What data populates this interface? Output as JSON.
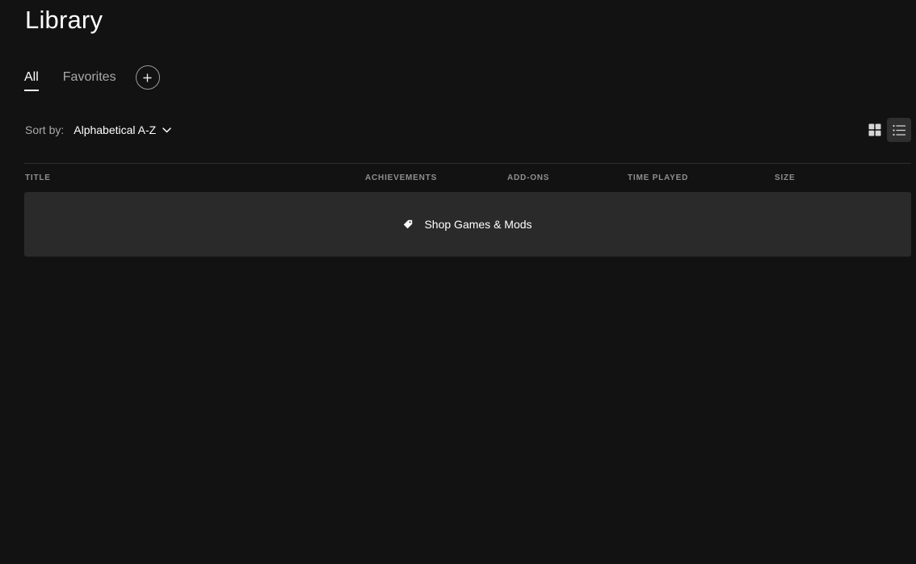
{
  "page": {
    "title": "Library"
  },
  "tabs": [
    {
      "label": "All",
      "active": true
    },
    {
      "label": "Favorites",
      "active": false
    }
  ],
  "add_collection": {
    "icon": "plus-icon"
  },
  "sort": {
    "label": "Sort by:",
    "value": "Alphabetical A-Z",
    "icon": "chevron-down-icon"
  },
  "view_toggles": {
    "grid_icon": "grid-view-icon",
    "list_icon": "list-view-icon",
    "active": "list"
  },
  "table": {
    "columns": [
      "TITLE",
      "ACHIEVEMENTS",
      "ADD-ONS",
      "TIME PLAYED",
      "SIZE"
    ]
  },
  "shop_row": {
    "label": "Shop Games & Mods",
    "icon": "tag-icon"
  },
  "colors": {
    "background": "#121212",
    "row_background": "#2a2a2a",
    "text_primary": "#ffffff",
    "text_secondary": "#a9a9a9"
  }
}
